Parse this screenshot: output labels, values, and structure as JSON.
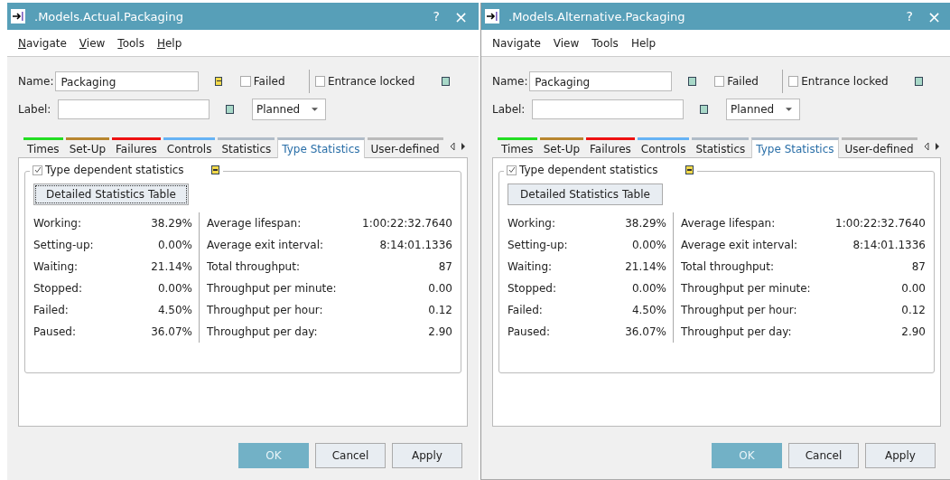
{
  "windows": [
    {
      "title": ".Models.Actual.Packaging",
      "help": "?",
      "close": "×",
      "menu": [
        {
          "label": "Navigate",
          "underlined": true
        },
        {
          "label": "View",
          "underlined": true
        },
        {
          "label": "Tools",
          "underlined": true
        },
        {
          "label": "Help",
          "underlined": true
        }
      ],
      "name_label": "Name:",
      "name_value": "Packaging",
      "name_indicator": {
        "kind": "changed"
      },
      "failed": {
        "label": "Failed",
        "checked": false
      },
      "entrance_locked": {
        "label": "Entrance locked",
        "checked": false
      },
      "entrance_indicator": {
        "kind": "plain"
      },
      "label_label": "Label:",
      "label_indicator": {
        "kind": "plain"
      },
      "status": "Planned",
      "tabs": [
        {
          "label": "Times",
          "color": "#22dd22",
          "selected": false
        },
        {
          "label": "Set-Up",
          "color": "#b8862f",
          "selected": false
        },
        {
          "label": "Failures",
          "color": "#ee1111",
          "selected": false
        },
        {
          "label": "Controls",
          "color": "#66b3f5",
          "selected": false
        },
        {
          "label": "Statistics",
          "color": "#b0bcc8",
          "selected": false
        },
        {
          "label": "Type Statistics",
          "color": "#b0bcc8",
          "selected": true
        },
        {
          "label": "User-defined",
          "color": "#bbbbbb",
          "selected": false
        }
      ],
      "group": {
        "label": "Type dependent statistics",
        "checked": true,
        "indicator": {
          "kind": "changed"
        },
        "button": {
          "label": "Detailed Statistics Table",
          "focused": true
        },
        "left_stats": [
          {
            "label": "Working:",
            "value": "38.29%"
          },
          {
            "label": "Setting-up:",
            "value": "0.00%"
          },
          {
            "label": "Waiting:",
            "value": "21.14%"
          },
          {
            "label": "Stopped:",
            "value": "0.00%"
          },
          {
            "label": "Failed:",
            "value": "4.50%"
          },
          {
            "label": "Paused:",
            "value": "36.07%"
          }
        ],
        "right_stats": [
          {
            "label": "Average lifespan:",
            "value": "1:00:22:32.7640"
          },
          {
            "label": "Average exit interval:",
            "value": "8:14:01.1336"
          },
          {
            "label": "Total throughput:",
            "value": "87"
          },
          {
            "label": "Throughput per minute:",
            "value": "0.00"
          },
          {
            "label": "Throughput per hour:",
            "value": "0.12"
          },
          {
            "label": "Throughput per day:",
            "value": "2.90"
          }
        ]
      },
      "buttons": [
        {
          "label": "OK",
          "kind": "primary"
        },
        {
          "label": "Cancel",
          "kind": "normal"
        },
        {
          "label": "Apply",
          "kind": "normal"
        }
      ]
    },
    {
      "title": ".Models.Alternative.Packaging",
      "help": "?",
      "close": "×",
      "menu": [
        {
          "label": "Navigate",
          "underlined": false
        },
        {
          "label": "View",
          "underlined": false
        },
        {
          "label": "Tools",
          "underlined": false
        },
        {
          "label": "Help",
          "underlined": false
        }
      ],
      "name_label": "Name:",
      "name_value": "Packaging",
      "name_indicator": {
        "kind": "plain"
      },
      "failed": {
        "label": "Failed",
        "checked": false
      },
      "entrance_locked": {
        "label": "Entrance locked",
        "checked": false
      },
      "entrance_indicator": {
        "kind": "plain"
      },
      "label_label": "Label:",
      "label_indicator": {
        "kind": "plain"
      },
      "status": "Planned",
      "tabs": [
        {
          "label": "Times",
          "color": "#22dd22",
          "selected": false
        },
        {
          "label": "Set-Up",
          "color": "#b8862f",
          "selected": false
        },
        {
          "label": "Failures",
          "color": "#ee1111",
          "selected": false
        },
        {
          "label": "Controls",
          "color": "#66b3f5",
          "selected": false
        },
        {
          "label": "Statistics",
          "color": "#b0bcc8",
          "selected": false
        },
        {
          "label": "Type Statistics",
          "color": "#b0bcc8",
          "selected": true
        },
        {
          "label": "User-defined",
          "color": "#bbbbbb",
          "selected": false
        }
      ],
      "group": {
        "label": "Type dependent statistics",
        "checked": true,
        "indicator": {
          "kind": "changed"
        },
        "button": {
          "label": "Detailed Statistics Table",
          "focused": false
        },
        "left_stats": [
          {
            "label": "Working:",
            "value": "38.29%"
          },
          {
            "label": "Setting-up:",
            "value": "0.00%"
          },
          {
            "label": "Waiting:",
            "value": "21.14%"
          },
          {
            "label": "Stopped:",
            "value": "0.00%"
          },
          {
            "label": "Failed:",
            "value": "4.50%"
          },
          {
            "label": "Paused:",
            "value": "36.07%"
          }
        ],
        "right_stats": [
          {
            "label": "Average lifespan:",
            "value": "1:00:22:32.7640"
          },
          {
            "label": "Average exit interval:",
            "value": "8:14:01.1336"
          },
          {
            "label": "Total throughput:",
            "value": "87"
          },
          {
            "label": "Throughput per minute:",
            "value": "0.00"
          },
          {
            "label": "Throughput per hour:",
            "value": "0.12"
          },
          {
            "label": "Throughput per day:",
            "value": "2.90"
          }
        ]
      },
      "buttons": [
        {
          "label": "OK",
          "kind": "primary"
        },
        {
          "label": "Cancel",
          "kind": "normal"
        },
        {
          "label": "Apply",
          "kind": "normal"
        }
      ]
    }
  ]
}
